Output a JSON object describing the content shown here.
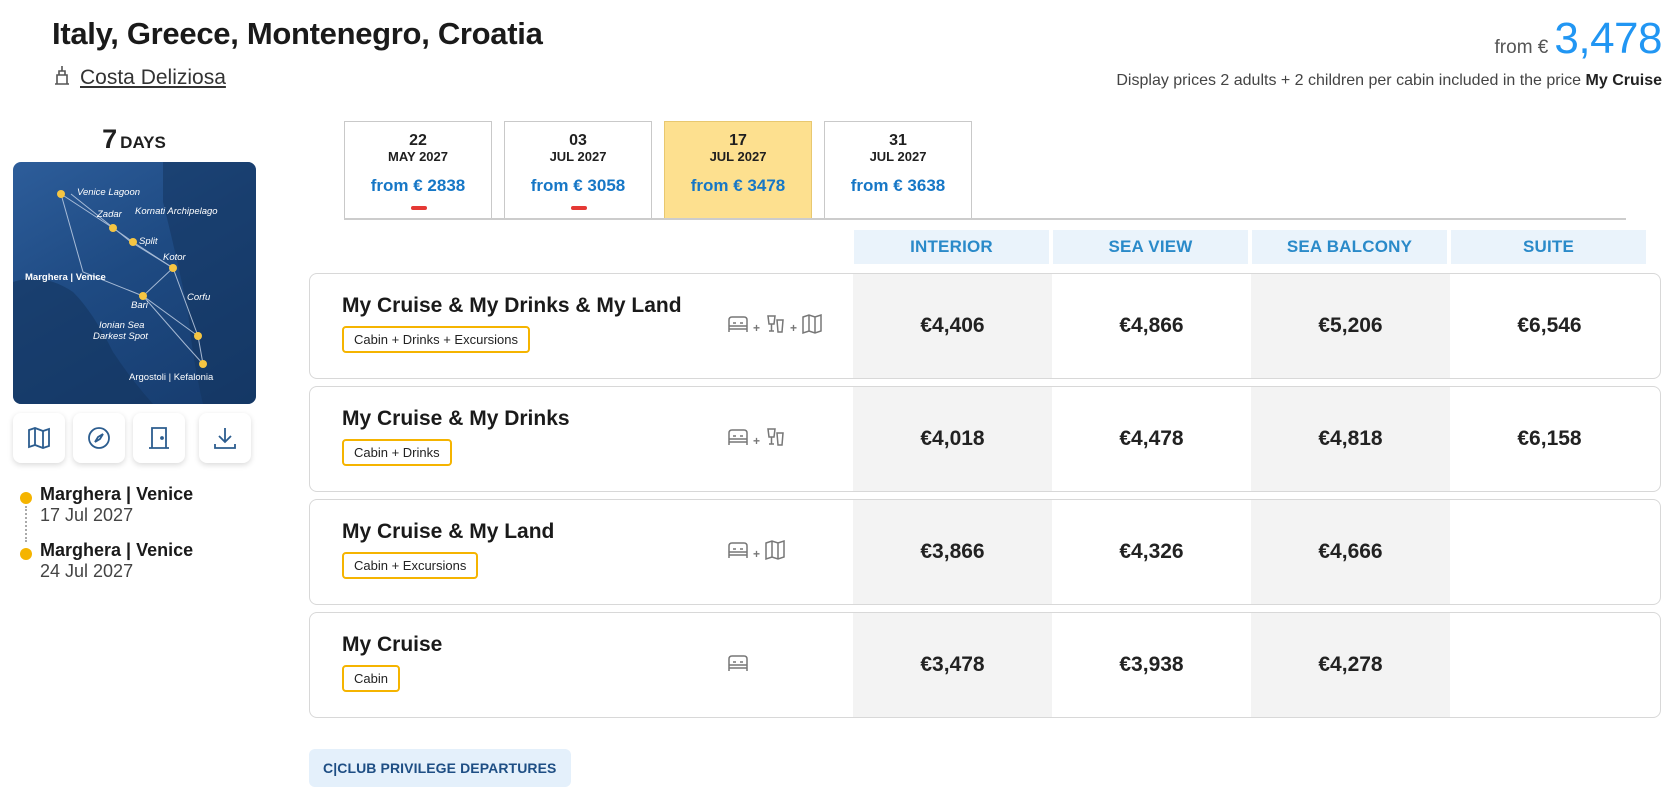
{
  "header": {
    "title": "Italy, Greece, Montenegro, Croatia",
    "ship": "Costa Deliziosa",
    "price_from_label": "from €",
    "price_from_value": "3,478",
    "display_note_prefix": "Display prices 2 adults + 2 children per cabin included in the price",
    "display_note_package": "My Cruise"
  },
  "duration": {
    "number": "7",
    "unit": "DAYS"
  },
  "map": {
    "labels": [
      "Venice Lagoon",
      "Zadar",
      "Kornati Archipelago",
      "Split",
      "Kotor",
      "Marghera | Venice",
      "Corfu",
      "Bari",
      "Ionian Sea",
      "Darkest Spot",
      "Argostoli | Kefalonia"
    ],
    "tools": [
      "map-icon",
      "compass-icon",
      "door-icon",
      "download-icon"
    ]
  },
  "itinerary": [
    {
      "port": "Marghera | Venice",
      "date": "17 Jul 2027"
    },
    {
      "port": "Marghera | Venice",
      "date": "24 Jul 2027"
    }
  ],
  "date_tabs": [
    {
      "day": "22",
      "month": "MAY 2027",
      "price": "from € 2838",
      "active": false,
      "dash": true
    },
    {
      "day": "03",
      "month": "JUL 2027",
      "price": "from € 3058",
      "active": false,
      "dash": true
    },
    {
      "day": "17",
      "month": "JUL 2027",
      "price": "from € 3478",
      "active": true,
      "dash": false
    },
    {
      "day": "31",
      "month": "JUL 2027",
      "price": "from € 3638",
      "active": false,
      "dash": false
    }
  ],
  "columns": [
    "INTERIOR",
    "SEA VIEW",
    "SEA BALCONY",
    "SUITE"
  ],
  "packages": [
    {
      "name": "My Cruise & My Drinks & My Land",
      "badge": "Cabin + Drinks + Excursions",
      "prices": [
        "€4,406",
        "€4,866",
        "€5,206",
        "€6,546"
      ]
    },
    {
      "name": "My Cruise & My Drinks",
      "badge": "Cabin + Drinks",
      "prices": [
        "€4,018",
        "€4,478",
        "€4,818",
        "€6,158"
      ]
    },
    {
      "name": "My Cruise & My Land",
      "badge": "Cabin + Excursions",
      "prices": [
        "€3,866",
        "€4,326",
        "€4,666",
        ""
      ]
    },
    {
      "name": "My Cruise",
      "badge": "Cabin",
      "prices": [
        "€3,478",
        "€3,938",
        "€4,278",
        ""
      ]
    }
  ],
  "club_button": "C|CLUB PRIVILEGE DEPARTURES",
  "colors": {
    "accent_blue": "#2196f3",
    "active_tab": "#fde08f",
    "badge_border": "#f5b400",
    "dash_red": "#e53935"
  }
}
